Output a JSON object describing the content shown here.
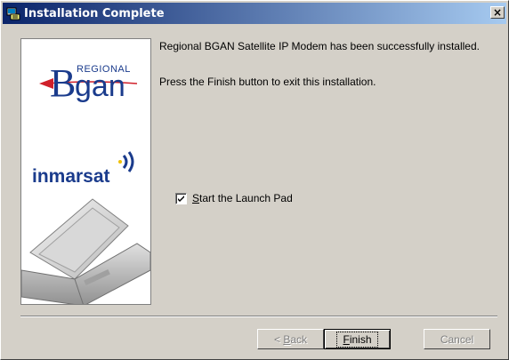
{
  "window": {
    "title": "Installation Complete"
  },
  "sidebar": {
    "brand_small": "REGIONAL",
    "brand_large": "gan",
    "brand_b": "B",
    "partner": "inmarsat"
  },
  "content": {
    "message1": "Regional BGAN Satellite IP Modem has been successfully installed.",
    "message2": "Press the Finish button to exit this installation."
  },
  "options": {
    "launch_pad": {
      "label_prefix": "S",
      "label_rest": "tart the Launch Pad",
      "checked": true
    }
  },
  "buttons": {
    "back": {
      "prefix": "< ",
      "accel": "B",
      "rest": "ack"
    },
    "finish": {
      "accel": "F",
      "rest": "inish"
    },
    "cancel": "Cancel"
  },
  "colors": {
    "title_start": "#0a246a",
    "title_end": "#a6caf0",
    "brand_blue": "#1a3b8c",
    "brand_red": "#d0202a"
  }
}
